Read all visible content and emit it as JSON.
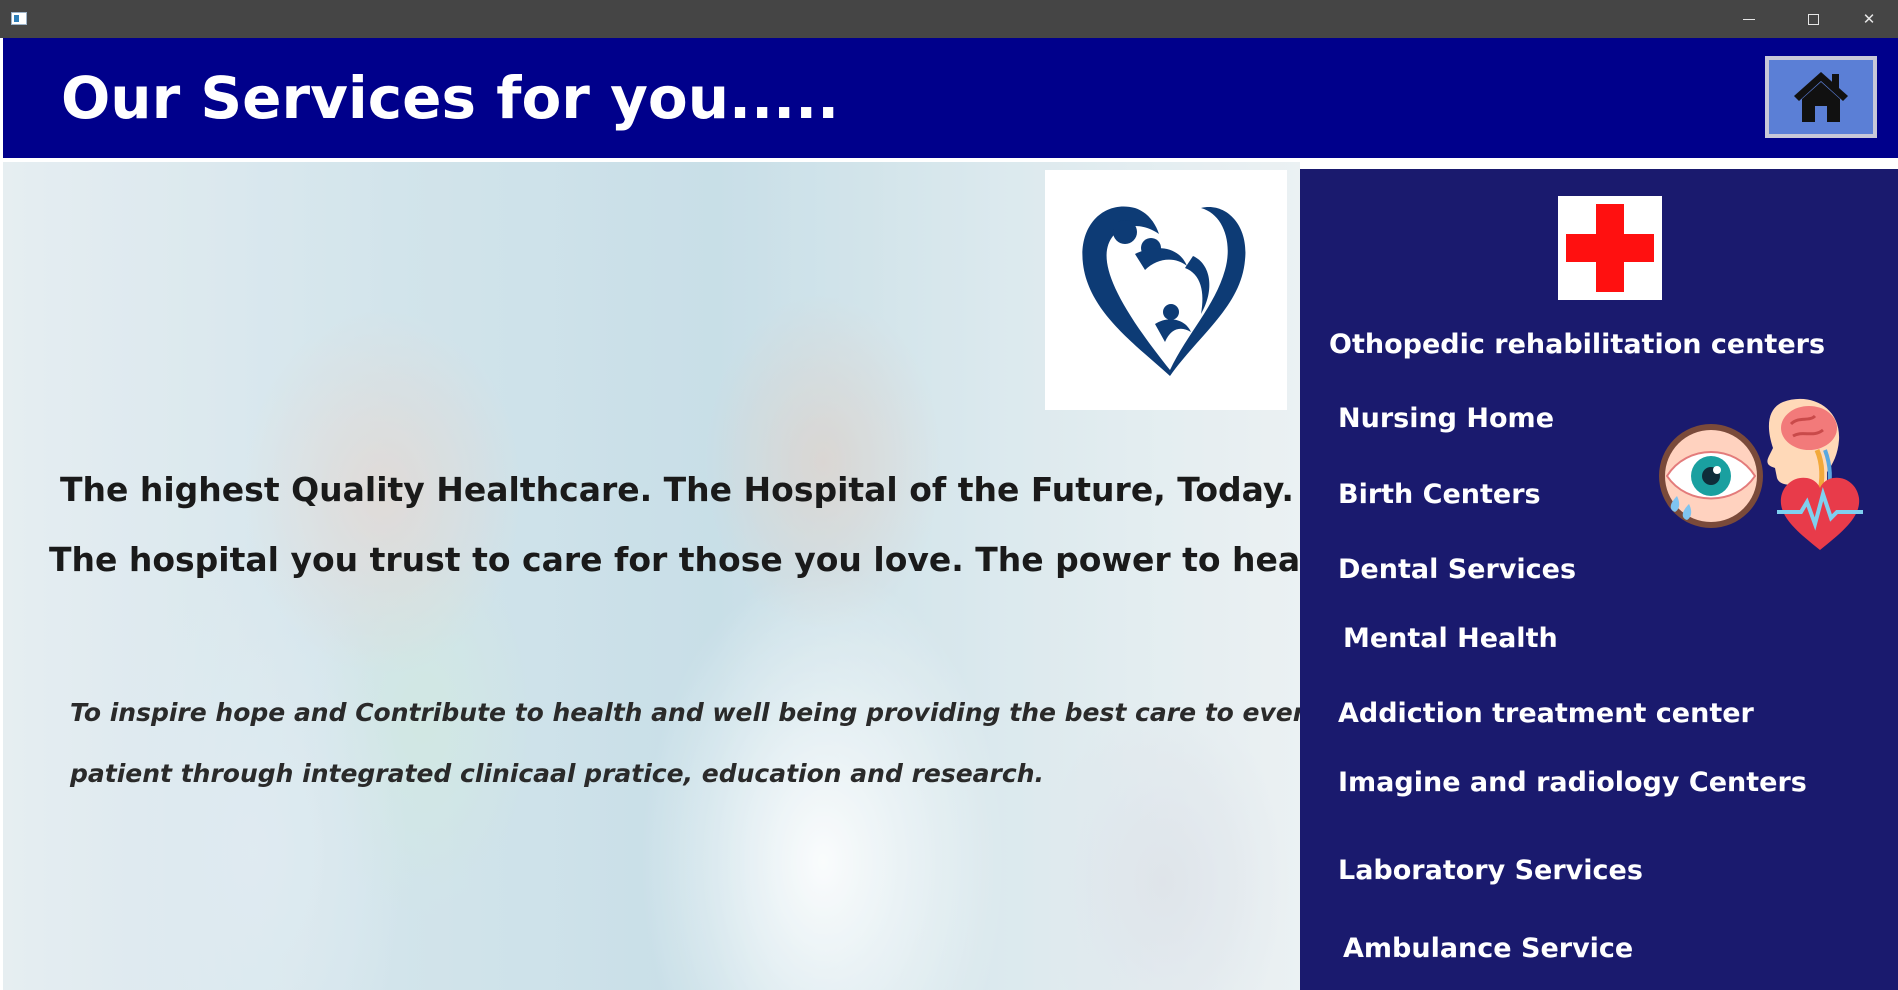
{
  "window": {
    "minimize_label": "—",
    "maximize_label": "☐",
    "close_label": "✕"
  },
  "header": {
    "title": "Our Services for you.....",
    "home_icon": "home-icon"
  },
  "hero": {
    "taglines": [
      "The highest Quality Healthcare. The Hospital of the Future, Today.",
      "The hospital you trust to care for those you love. The power to heal."
    ],
    "mission": [
      "To inspire hope and Contribute to health and well being providing the best care to every",
      "patient through integrated clinicaal pratice, education and research."
    ],
    "logo_icon": "family-heart-logo",
    "photo": "doctor-high-five-family-photo"
  },
  "services": {
    "header_icon": "red-cross-icon",
    "items": [
      "Othopedic rehabilitation centers",
      "Nursing Home",
      "Birth Centers",
      "Dental Services",
      "Mental Health",
      "Addiction treatment center",
      "Imagine and radiology Centers",
      "Laboratory Services",
      "Ambulance Service"
    ],
    "decor_icons": [
      "brain-head-icon",
      "eye-icon",
      "heart-pulse-icon"
    ]
  },
  "colors": {
    "titlebar": "#454545",
    "header": "#00008b",
    "home_button": "#5b7fd6",
    "services_panel": "#1a1a6e",
    "cross": "#ff1010",
    "logo": "#0d3b75"
  }
}
